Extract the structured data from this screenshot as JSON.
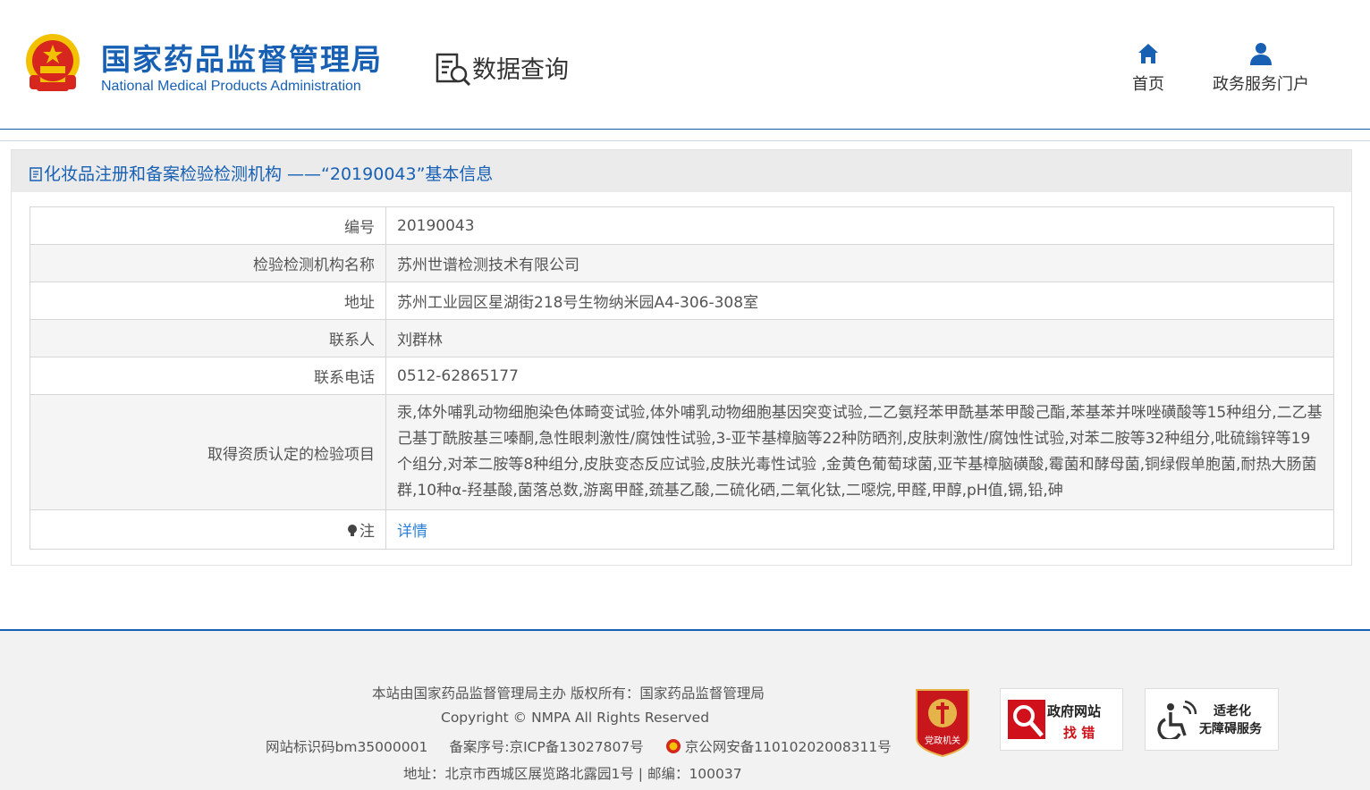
{
  "header": {
    "org_name_cn": "国家药品监督管理局",
    "org_name_en": "National Medical Products Administration",
    "section_title": "数据查询",
    "nav": {
      "home_label": "首页",
      "portal_label": "政务服务门户"
    }
  },
  "panel": {
    "title": "化妆品注册和备案检验检测机构 ——“20190043”基本信息",
    "rows": [
      {
        "label": "编号",
        "value": "20190043"
      },
      {
        "label": "检验检测机构名称",
        "value": "苏州世谱检测技术有限公司"
      },
      {
        "label": "地址",
        "value": "苏州工业园区星湖街218号生物纳米园A4-306-308室"
      },
      {
        "label": "联系人",
        "value": "刘群林"
      },
      {
        "label": "联系电话",
        "value": "0512-62865177"
      },
      {
        "label": "取得资质认定的检验项目",
        "value": "汞,体外哺乳动物细胞染色体畸变试验,体外哺乳动物细胞基因突变试验,二乙氨羟苯甲酰基苯甲酸己酯,苯基苯并咪唑磺酸等15种组分,二乙基己基丁酰胺基三嗪酮,急性眼刺激性/腐蚀性试验,3-亚苄基樟脑等22种防晒剂,皮肤刺激性/腐蚀性试验,对苯二胺等32种组分,吡硫鎓锌等19个组分,对苯二胺等8种组分,皮肤变态反应试验,皮肤光毒性试验 ,金黄色葡萄球菌,亚苄基樟脑磺酸,霉菌和酵母菌,铜绿假单胞菌,耐热大肠菌群,10种α-羟基酸,菌落总数,游离甲醛,巯基乙酸,二硫化硒,二氧化钛,二噁烷,甲醛,甲醇,pH值,镉,铅,砷"
      }
    ],
    "note_label": "注",
    "note_link": "详情"
  },
  "footer": {
    "line1": "本站由国家药品监督管理局主办 版权所有：国家药品监督管理局",
    "line2": "Copyright © NMPA All Rights Reserved",
    "site_code": "网站标识码bm35000001",
    "icp": "备案序号:京ICP备13027807号",
    "police": "京公网安备11010202008311号",
    "address": "地址：北京市西城区展览路北露园1号 | 邮编：100037",
    "badge_party": "党政机关",
    "badge_gov_1": "政府网站",
    "badge_gov_2": "找 错",
    "badge_acc_1": "适老化",
    "badge_acc_2": "无障碍服务"
  },
  "colors": {
    "brand_blue": "#1760b4",
    "link_blue": "#2c82d8",
    "emblem_red": "#d7261e",
    "emblem_gold": "#f2c200"
  }
}
